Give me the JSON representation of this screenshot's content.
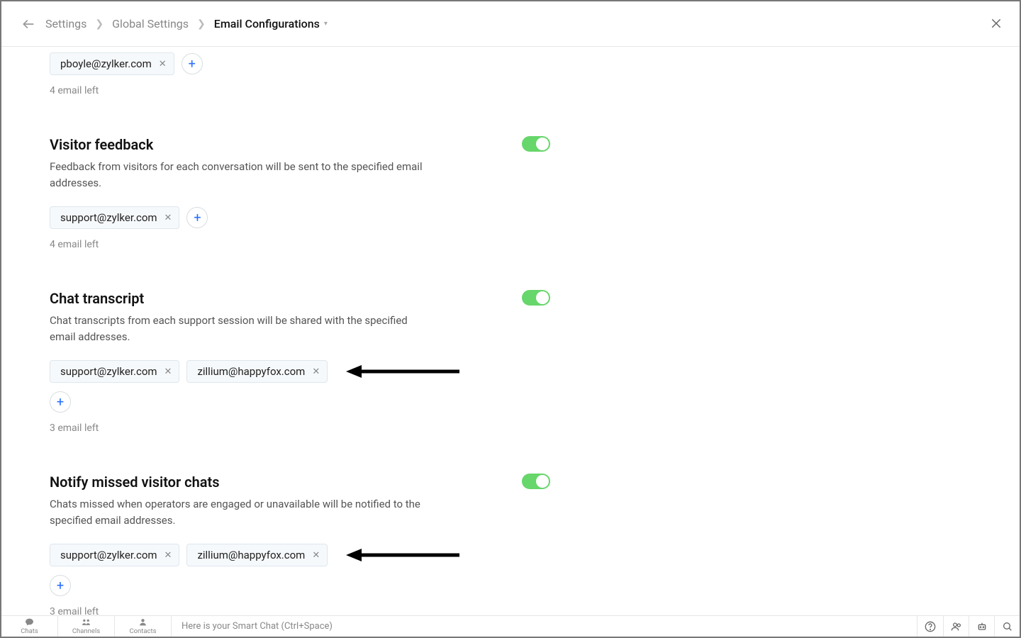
{
  "breadcrumb": {
    "root": "Settings",
    "mid": "Global Settings",
    "current": "Email Configurations"
  },
  "sections": {
    "top": {
      "emails": [
        "pboyle@zylker.com"
      ],
      "counter": "4 email left"
    },
    "feedback": {
      "title": "Visitor feedback",
      "desc": "Feedback from visitors for each conversation will be sent to the specified email addresses.",
      "emails": [
        "support@zylker.com"
      ],
      "counter": "4 email left"
    },
    "transcript": {
      "title": "Chat transcript",
      "desc": "Chat transcripts from each support session will be shared with the specified email addresses.",
      "emails": [
        "support@zylker.com",
        "zillium@happyfox.com"
      ],
      "counter": "3 email left"
    },
    "missed": {
      "title": "Notify missed visitor chats",
      "desc": "Chats missed when operators are engaged or unavailable will be notified to the specified email addresses.",
      "emails": [
        "support@zylker.com",
        "zillium@happyfox.com"
      ],
      "counter": "3 email left"
    }
  },
  "bottom": {
    "chats": "Chats",
    "channels": "Channels",
    "contacts": "Contacts",
    "smartchat": "Here is your Smart Chat (Ctrl+Space)"
  }
}
